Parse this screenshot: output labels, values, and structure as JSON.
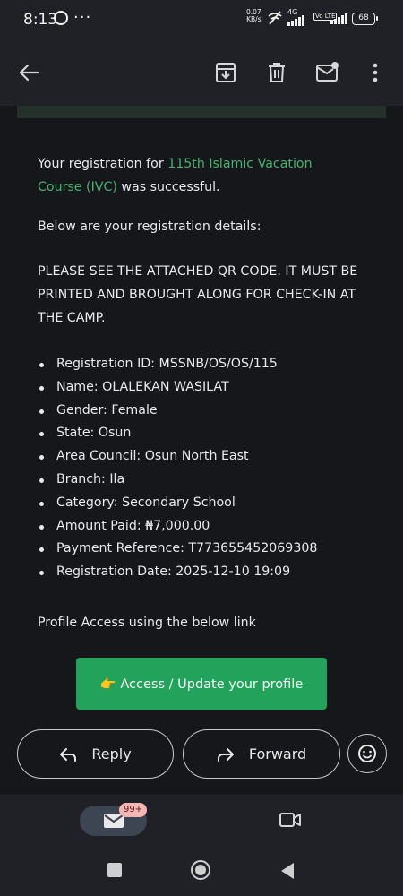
{
  "status_bar": {
    "time": "8:13",
    "net_speed_value": "0.07",
    "net_speed_unit": "KB/s",
    "network_type": "4G",
    "volte_label": "Vo LTE",
    "battery": "68"
  },
  "email": {
    "intro_prefix": "Your registration for ",
    "intro_link": "115th Islamic Vacation Course (IVC)",
    "intro_suffix": " was successful.",
    "details_intro": "Below are your registration details:",
    "notice": "PLEASE SEE THE ATTACHED QR CODE. IT MUST BE PRINTED AND BROUGHT ALONG FOR CHECK-IN AT THE CAMP.",
    "details": [
      "Registration ID: MSSNB/OS/OS/115",
      "Name: OLALEKAN WASILAT",
      "Gender: Female",
      "State: Osun",
      "Area Council: Osun North East",
      "Branch: Ila",
      "Category: Secondary School",
      "Amount Paid: ₦7,000.00",
      "Payment Reference: T773655452069308",
      "Registration Date: 2025-12-10 19:09"
    ],
    "profile_text": "Profile Access using the below link",
    "cta_label": "👉 Access / Update your profile"
  },
  "actions": {
    "reply": "Reply",
    "forward": "Forward"
  },
  "bottom_nav": {
    "mail_badge": "99+"
  },
  "colors": {
    "link": "#41b36d",
    "cta_background": "#22a25b",
    "badge": "#f4b6b3"
  }
}
